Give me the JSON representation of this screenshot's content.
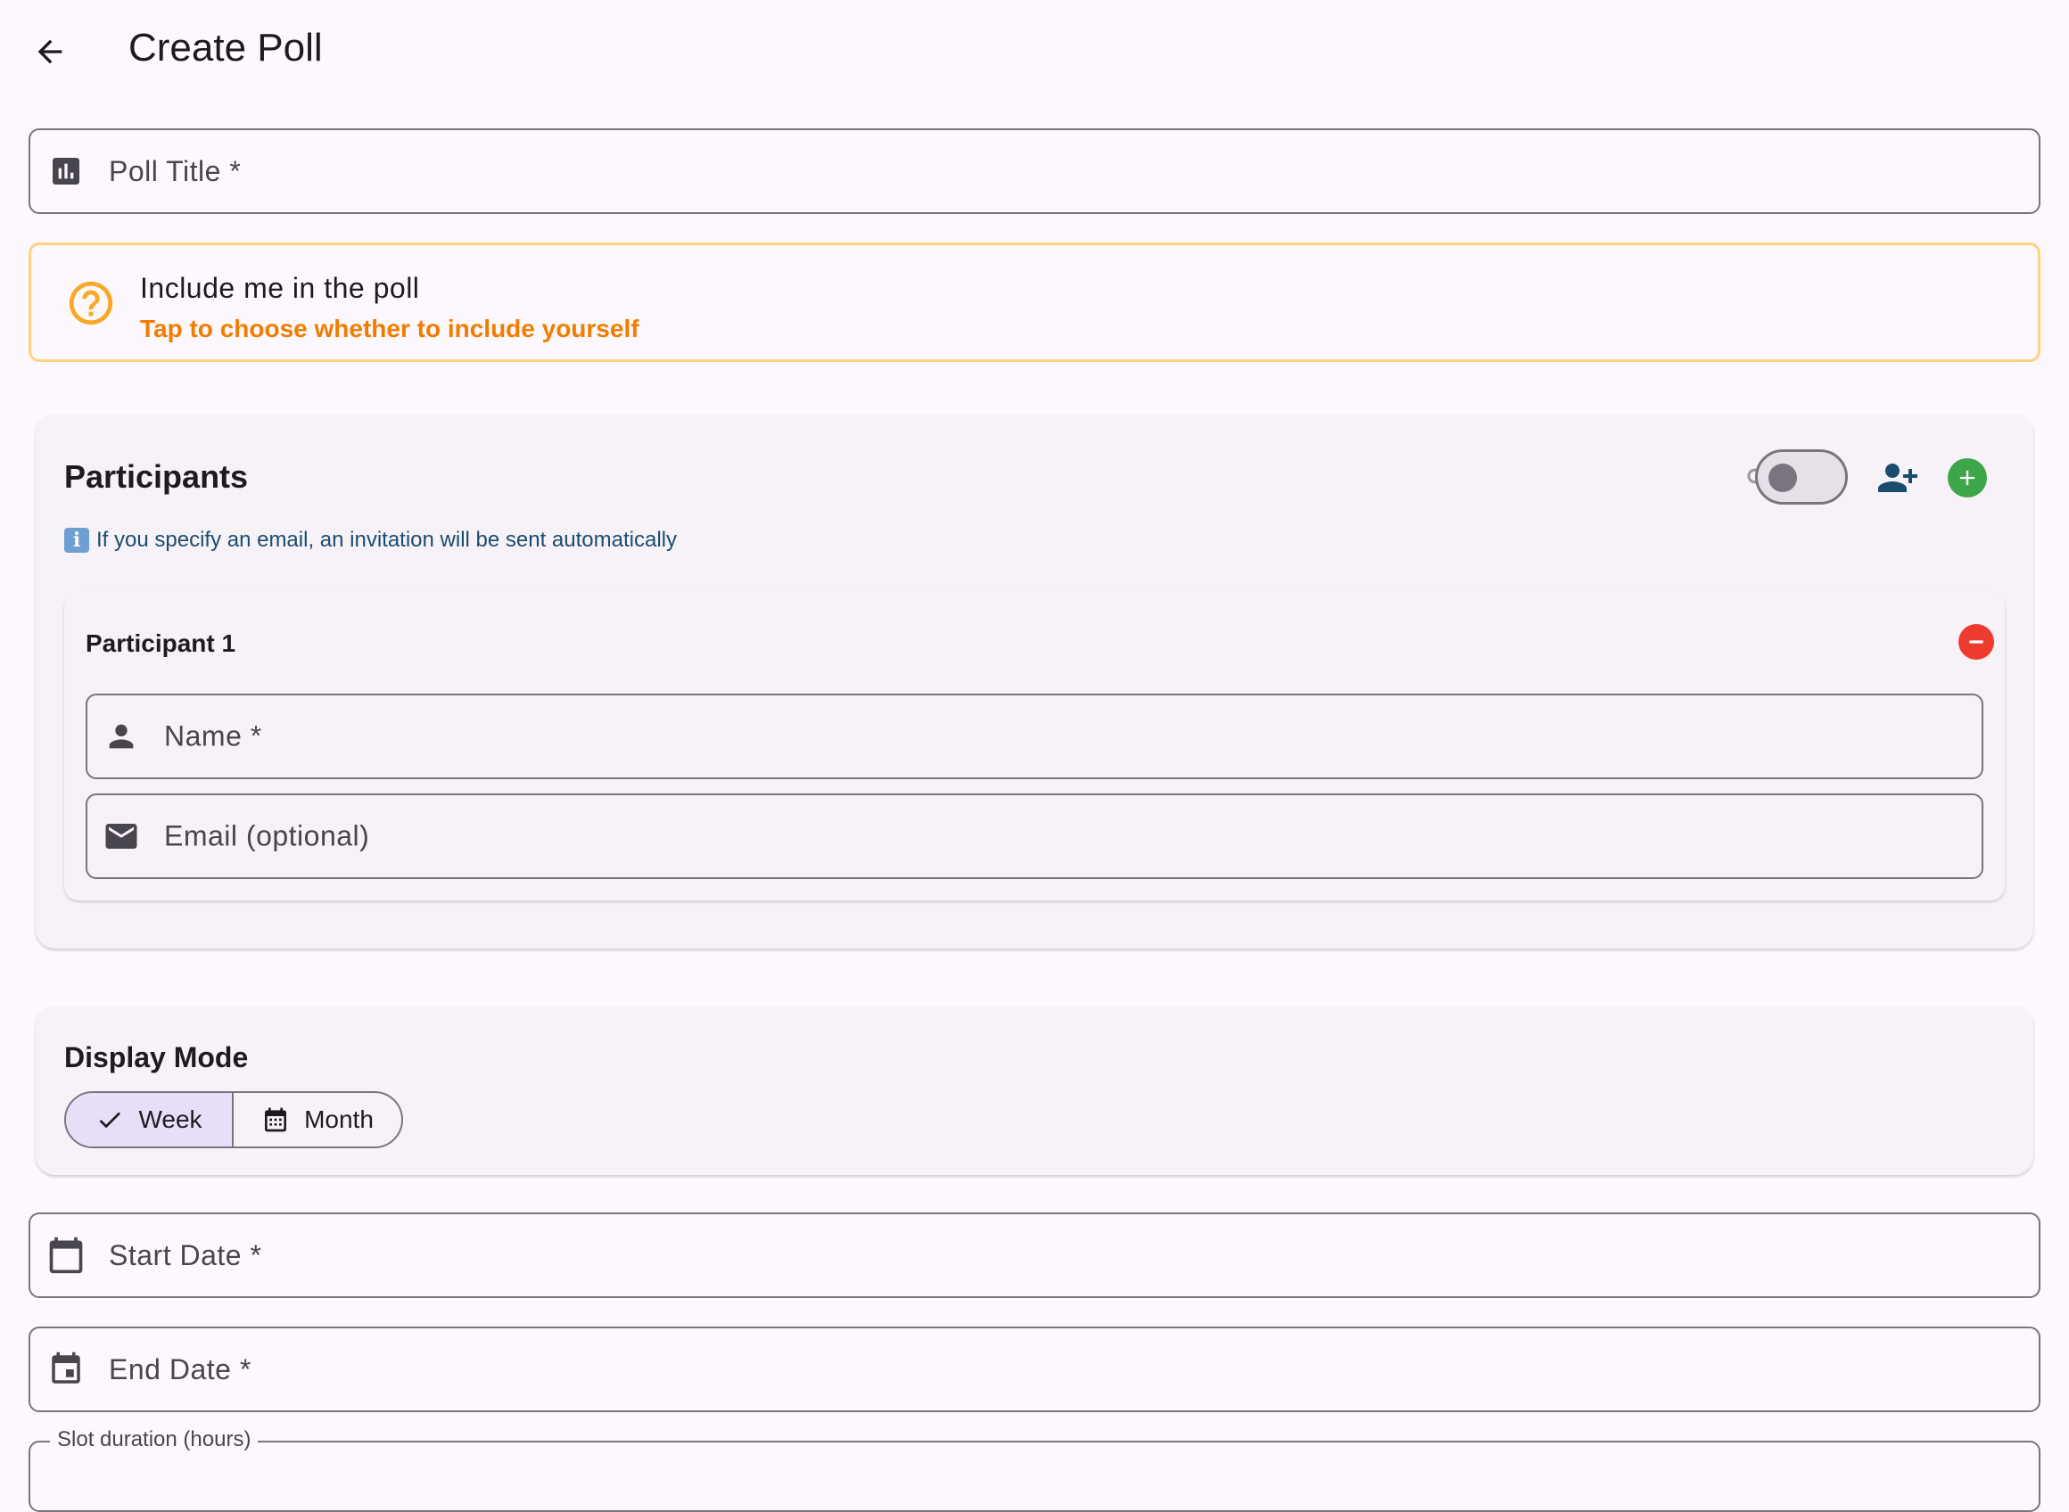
{
  "app_bar": {
    "title": "Create Poll"
  },
  "poll_title_field": {
    "label": "Poll Title *"
  },
  "include_me": {
    "title": "Include me in the poll",
    "subtitle": "Tap to choose whether to include yourself"
  },
  "participants": {
    "title": "Participants",
    "info": "If you specify an email, an invitation will be sent automatically",
    "toggle_on": false,
    "items": [
      {
        "title": "Participant 1",
        "name_label": "Name *",
        "email_label": "Email (optional)"
      }
    ]
  },
  "display_mode": {
    "title": "Display Mode",
    "options": [
      {
        "label": "Week",
        "selected": true,
        "icon": "check-icon"
      },
      {
        "label": "Month",
        "selected": false,
        "icon": "calendar-month-icon"
      }
    ]
  },
  "start_date_field": {
    "label": "Start Date *"
  },
  "end_date_field": {
    "label": "End Date *"
  },
  "slot_duration_field": {
    "label": "Slot duration (hours)"
  },
  "colors": {
    "background": "#fdf8fd",
    "warning_border": "#ffd27f",
    "warning_text": "#f17c00",
    "add_green": "#3fa54a",
    "remove_red": "#ee3b2f",
    "info_blue": "#1b4c6e",
    "selected_segment": "#e8def8"
  }
}
